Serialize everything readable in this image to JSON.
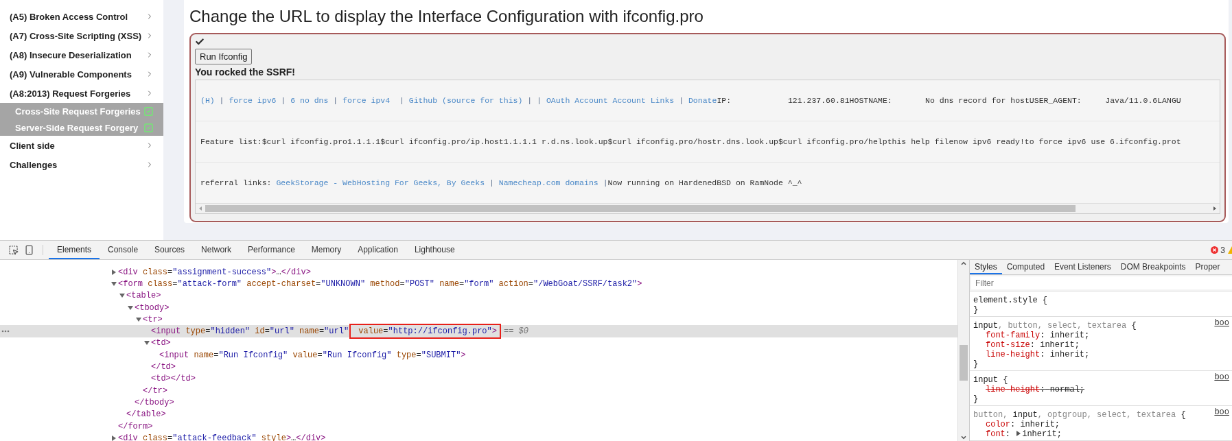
{
  "sidebar": {
    "items": [
      {
        "label": "(A5) Broken Access Control"
      },
      {
        "label": "(A7) Cross-Site Scripting (XSS)"
      },
      {
        "label": "(A8) Insecure Deserialization"
      },
      {
        "label": "(A9) Vulnerable Components"
      },
      {
        "label": "(A8:2013) Request Forgeries",
        "children": [
          {
            "label": "Cross-Site Request Forgeries",
            "completed": true
          },
          {
            "label": "Server-Side Request Forgery",
            "completed": true
          }
        ]
      },
      {
        "label": "Client side"
      },
      {
        "label": "Challenges"
      }
    ]
  },
  "lesson": {
    "title": "Change the URL to display the Interface Configuration with ifconfig.pro",
    "solved": true,
    "button": "Run Ifconfig",
    "feedback": "You rocked the SSRF!",
    "output": [
      [
        {
          "kind": "link",
          "text": "(H)"
        },
        {
          "kind": "sep",
          "text": " | "
        },
        {
          "kind": "link",
          "text": "force ipv6"
        },
        {
          "kind": "sep",
          "text": " | "
        },
        {
          "kind": "link",
          "text": "6 no dns"
        },
        {
          "kind": "sep",
          "text": " | "
        },
        {
          "kind": "link",
          "text": "force ipv4"
        },
        {
          "kind": "sep",
          "text": "  | "
        },
        {
          "kind": "link",
          "text": "Github (source for this)"
        },
        {
          "kind": "sep",
          "text": " | | "
        },
        {
          "kind": "link",
          "text": "OAuth Account Account Links"
        },
        {
          "kind": "sep",
          "text": " | "
        },
        {
          "kind": "link",
          "text": "Donate"
        },
        {
          "kind": "text",
          "text": "IP:            121.237.60.81HOSTNAME:       No dns record for hostUSER_AGENT:     Java/11.0.6LANGU"
        }
      ],
      [
        {
          "kind": "text",
          "text": "Feature list:$curl ifconfig.pro1.1.1.1$curl ifconfig.pro/ip.host1.1.1.1 r.d.ns.look.up$curl ifconfig.pro/hostr.dns.look.up$curl ifconfig.pro/helpthis help filenow ipv6 ready!to force ipv6 use 6.ifconfig.prot"
        }
      ],
      [
        {
          "kind": "text",
          "text": "referral links: "
        },
        {
          "kind": "link",
          "text": "GeekStorage - WebHosting For Geeks, By Geeks"
        },
        {
          "kind": "sep",
          "text": " | "
        },
        {
          "kind": "link",
          "text": "Namecheap.com domains"
        },
        {
          "kind": "sep",
          "text": " |"
        },
        {
          "kind": "text",
          "text": "Now running on HardenedBSD on RamNode ^_^"
        }
      ]
    ]
  },
  "devtools": {
    "tabs": [
      {
        "label": "Elements",
        "selected": true
      },
      {
        "label": "Console",
        "selected": false
      },
      {
        "label": "Sources",
        "selected": false
      },
      {
        "label": "Network",
        "selected": false
      },
      {
        "label": "Performance",
        "selected": false
      },
      {
        "label": "Memory",
        "selected": false
      },
      {
        "label": "Application",
        "selected": false
      },
      {
        "label": "Lighthouse",
        "selected": false
      }
    ],
    "error_count": "3",
    "elements": [
      {
        "text": "<div class=\"assignment-success\">…</div>",
        "expanded": false
      },
      {
        "text": "<form class=\"attack-form\" accept-charset=\"UNKNOWN\" method=\"POST\" name=\"form\" action=\"/WebGoat/SSRF/task2\">",
        "expanded": true,
        "close": "</form>",
        "children": [
          {
            "text": "<table>",
            "expanded": true,
            "close": "</table>",
            "children": [
              {
                "text": "<tbody>",
                "expanded": true,
                "close": "</tbody>",
                "children": [
                  {
                    "text": "<tr>",
                    "expanded": true,
                    "close": "</tr>",
                    "children": [
                      {
                        "text": "<input type=\"hidden\" id=\"url\" name=\"url\"",
                        "highlighted_text": " value=\"http://ifconfig.pro\">",
                        "selected": true,
                        "console_ref": "== $0"
                      },
                      {
                        "text": "<td>",
                        "expanded": true,
                        "close": "</td>",
                        "children": [
                          {
                            "text": "<input name=\"Run Ifconfig\" value=\"Run Ifconfig\" type=\"SUBMIT\">"
                          }
                        ]
                      },
                      {
                        "text": "<td></td>"
                      }
                    ]
                  }
                ]
              }
            ]
          }
        ]
      },
      {
        "text": "<div class=\"attack-feedback\" style>…</div>",
        "expanded": false
      }
    ],
    "styles": {
      "tabs": [
        {
          "label": "Styles",
          "selected": true
        },
        {
          "label": "Computed",
          "selected": false
        },
        {
          "label": "Event Listeners",
          "selected": false
        },
        {
          "label": "DOM Breakpoints",
          "selected": false
        },
        {
          "label": "Proper",
          "selected": false
        }
      ],
      "filter_placeholder": "Filter",
      "rules": [
        {
          "selector": [
            {
              "text": "element.style",
              "matched": true
            }
          ],
          "open": " {",
          "close": "}"
        },
        {
          "selector": [
            {
              "text": "input",
              "matched": true
            },
            {
              "text": ", button, select, textarea",
              "matched": false
            }
          ],
          "open": " {",
          "close": "}",
          "source": "boo",
          "declarations": [
            {
              "property": "font-family",
              "colon": ":",
              "value": "inherit;",
              "overridden": false
            },
            {
              "property": "font-size",
              "colon": ":",
              "value": "inherit;",
              "overridden": false
            },
            {
              "property": "line-height",
              "colon": ":",
              "value": "inherit;",
              "overridden": false
            }
          ]
        },
        {
          "selector": [
            {
              "text": "input",
              "matched": true
            }
          ],
          "open": " {",
          "close": "}",
          "source": "boo",
          "declarations": [
            {
              "property": "line-height",
              "colon": ":",
              "value": "normal;",
              "overridden": true
            }
          ]
        },
        {
          "selector": [
            {
              "text": "button, ",
              "matched": false
            },
            {
              "text": "input",
              "matched": true
            },
            {
              "text": ", optgroup, select, textarea",
              "matched": false
            }
          ],
          "open": " {",
          "source": "boo",
          "declarations": [
            {
              "property": "color",
              "colon": ":",
              "value": "inherit;",
              "overridden": false
            },
            {
              "property": "font",
              "colon": ":",
              "value": "inherit;",
              "overridden": false,
              "expandable": true
            }
          ]
        }
      ]
    }
  }
}
